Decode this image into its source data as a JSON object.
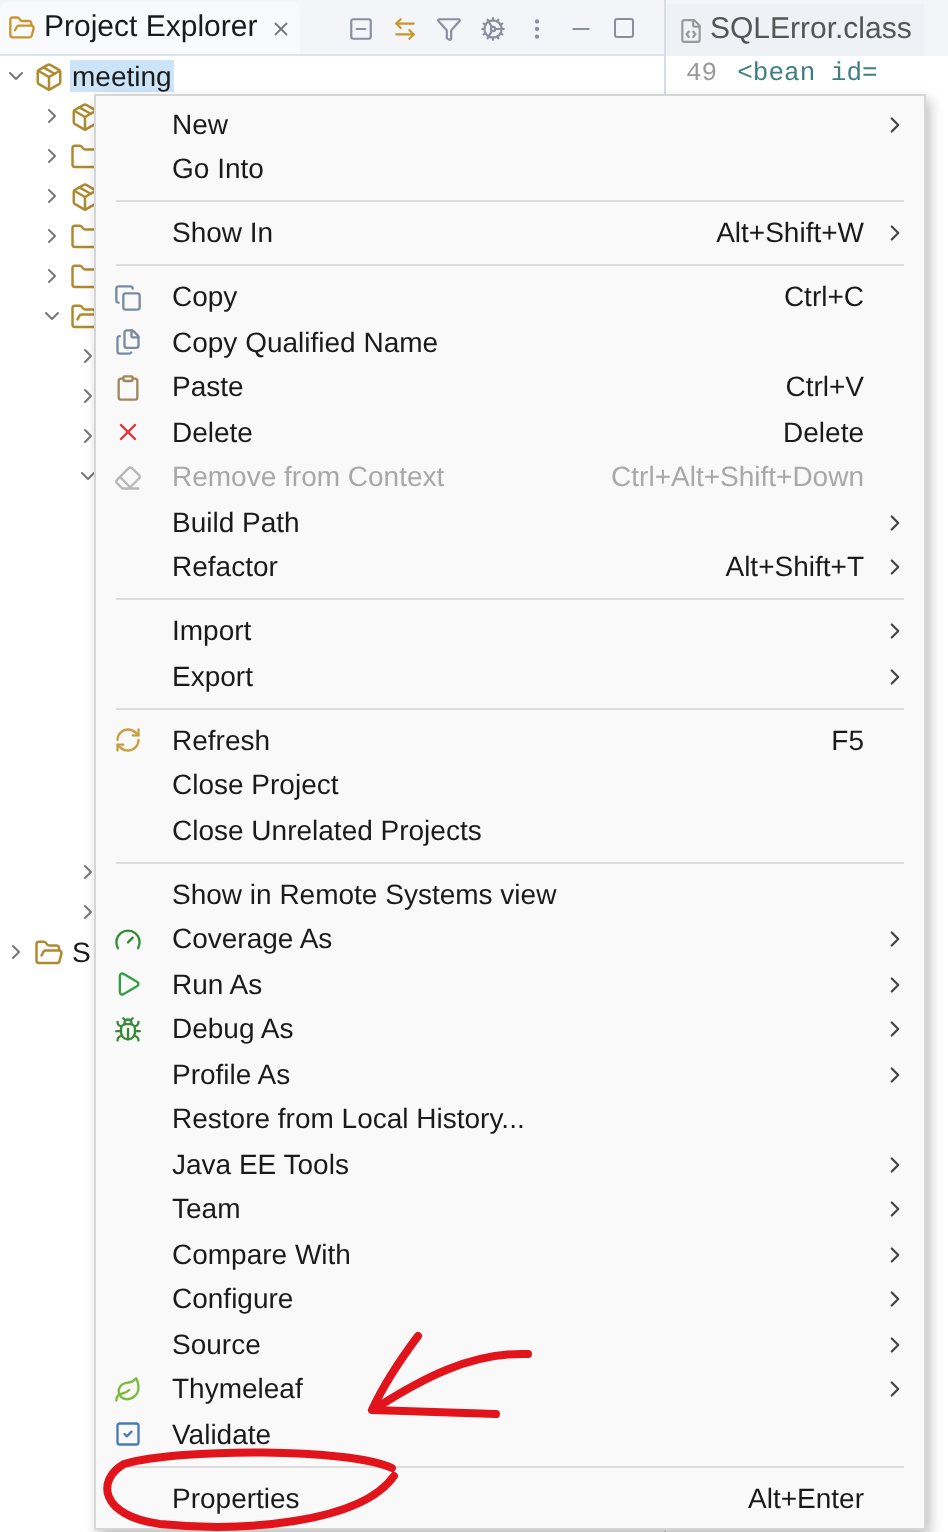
{
  "explorer": {
    "tab": {
      "title": "Project Explorer"
    },
    "tree": [
      {
        "label": "meeting",
        "expanded": true,
        "selected": true,
        "children": [
          {
            "expanded": false
          },
          {
            "expanded": false
          },
          {
            "expanded": false
          },
          {
            "expanded": false
          },
          {
            "expanded": false
          },
          {
            "expanded": true,
            "children": [
              {
                "expanded": false
              },
              {
                "expanded": false
              },
              {
                "expanded": false
              },
              {
                "expanded": true
              },
              {
                "expanded": false
              },
              {
                "expanded": false
              }
            ]
          }
        ]
      },
      {
        "label": "S",
        "expanded": false,
        "selected": false
      }
    ]
  },
  "editor": {
    "tab": {
      "title": "SQLError.class"
    },
    "line_number": "49",
    "code": "<bean id="
  },
  "context_menu": {
    "items": [
      {
        "kind": "item",
        "label": "New",
        "submenu": true,
        "disabled": false
      },
      {
        "kind": "item",
        "label": "Go Into",
        "submenu": false,
        "disabled": false
      },
      {
        "kind": "separator"
      },
      {
        "kind": "item",
        "label": "Show In",
        "shortcut": "Alt+Shift+W",
        "submenu": true,
        "disabled": false
      },
      {
        "kind": "separator"
      },
      {
        "kind": "item",
        "label": "Copy",
        "shortcut": "Ctrl+C",
        "submenu": false,
        "disabled": false
      },
      {
        "kind": "item",
        "label": "Copy Qualified Name",
        "submenu": false,
        "disabled": false
      },
      {
        "kind": "item",
        "label": "Paste",
        "shortcut": "Ctrl+V",
        "submenu": false,
        "disabled": false
      },
      {
        "kind": "item",
        "label": "Delete",
        "shortcut": "Delete",
        "submenu": false,
        "disabled": false
      },
      {
        "kind": "item",
        "label": "Remove from Context",
        "shortcut": "Ctrl+Alt+Shift+Down",
        "submenu": false,
        "disabled": true
      },
      {
        "kind": "item",
        "label": "Build Path",
        "submenu": true,
        "disabled": false
      },
      {
        "kind": "item",
        "label": "Refactor",
        "shortcut": "Alt+Shift+T",
        "submenu": true,
        "disabled": false
      },
      {
        "kind": "separator"
      },
      {
        "kind": "item",
        "label": "Import",
        "submenu": true,
        "disabled": false
      },
      {
        "kind": "item",
        "label": "Export",
        "submenu": true,
        "disabled": false
      },
      {
        "kind": "separator"
      },
      {
        "kind": "item",
        "label": "Refresh",
        "shortcut": "F5",
        "submenu": false,
        "disabled": false
      },
      {
        "kind": "item",
        "label": "Close Project",
        "submenu": false,
        "disabled": false
      },
      {
        "kind": "item",
        "label": "Close Unrelated Projects",
        "submenu": false,
        "disabled": false
      },
      {
        "kind": "separator"
      },
      {
        "kind": "item",
        "label": "Show in Remote Systems view",
        "submenu": false,
        "disabled": false
      },
      {
        "kind": "item",
        "label": "Coverage As",
        "submenu": true,
        "disabled": false
      },
      {
        "kind": "item",
        "label": "Run As",
        "submenu": true,
        "disabled": false
      },
      {
        "kind": "item",
        "label": "Debug As",
        "submenu": true,
        "disabled": false
      },
      {
        "kind": "item",
        "label": "Profile As",
        "submenu": true,
        "disabled": false
      },
      {
        "kind": "item",
        "label": "Restore from Local History...",
        "submenu": false,
        "disabled": false
      },
      {
        "kind": "item",
        "label": "Java EE Tools",
        "submenu": true,
        "disabled": false
      },
      {
        "kind": "item",
        "label": "Team",
        "submenu": true,
        "disabled": false
      },
      {
        "kind": "item",
        "label": "Compare With",
        "submenu": true,
        "disabled": false
      },
      {
        "kind": "item",
        "label": "Configure",
        "submenu": true,
        "disabled": false
      },
      {
        "kind": "item",
        "label": "Source",
        "submenu": true,
        "disabled": false
      },
      {
        "kind": "item",
        "label": "Thymeleaf",
        "submenu": true,
        "disabled": false
      },
      {
        "kind": "item",
        "label": "Validate",
        "submenu": false,
        "disabled": false
      },
      {
        "kind": "separator"
      },
      {
        "kind": "item",
        "label": "Properties",
        "shortcut": "Alt+Enter",
        "submenu": false,
        "disabled": false
      }
    ]
  }
}
